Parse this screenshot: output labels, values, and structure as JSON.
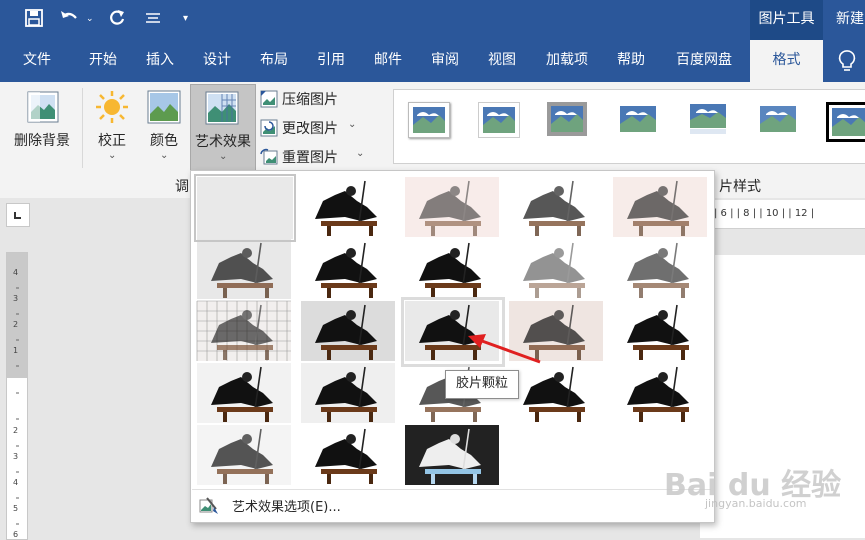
{
  "title_bar": {
    "context_tab_title": "图片工具",
    "new_label": "新建"
  },
  "menu_tabs": [
    "文件",
    "开始",
    "插入",
    "设计",
    "布局",
    "引用",
    "邮件",
    "审阅",
    "视图",
    "加载项",
    "帮助",
    "百度网盘",
    "格式"
  ],
  "ribbon": {
    "remove_bg": "删除背景",
    "correct": "校正",
    "color": "颜色",
    "art_effects": "艺术效果",
    "compress": "压缩图片",
    "change": "更改图片",
    "reset": "重置图片",
    "group_adjust_partial": "调",
    "group_styles_partial": "片样式"
  },
  "ruler_right": "| 6 |  | 8 |  | 10 |  | 12 |",
  "dropdown": {
    "tooltip": "胶片颗粒",
    "options_label": "艺术效果选项(E)..."
  },
  "watermark": {
    "main": "Bai du 经验",
    "sub": "jingyan.baidu.com"
  },
  "colors": {
    "accent": "#2b579a",
    "arrow": "#e02020"
  },
  "icons": [
    "save-icon",
    "undo-icon",
    "redo-icon",
    "customize-icon",
    "lightbulb-icon",
    "paintbrush-icon"
  ]
}
